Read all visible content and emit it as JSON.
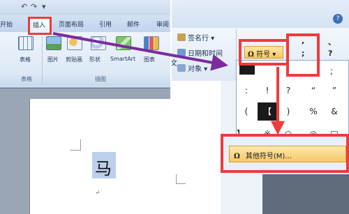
{
  "colors": {
    "highlight_red": "#ee3b3b",
    "arrow_purple": "#7b2b9e",
    "ribbon_blue": "#d6e3f3",
    "selection_blue": "#bcd0ec"
  },
  "left": {
    "qat_icons": [
      "undo-icon",
      "redo-icon",
      "customize-icon"
    ],
    "tabs": [
      "开始",
      "插入",
      "页面布局",
      "引用",
      "邮件",
      "审阅"
    ],
    "active_tab": "插入",
    "ribbon_items": [
      {
        "label": "表格",
        "icon": "table-icon"
      },
      {
        "label": "图片",
        "icon": "picture-icon"
      },
      {
        "label": "剪贴画",
        "icon": "clipart-icon"
      },
      {
        "label": "形状",
        "icon": "shapes-icon"
      },
      {
        "label": "SmartArt",
        "icon": "smartart-icon"
      },
      {
        "label": "图表",
        "icon": "chart-icon"
      }
    ],
    "groups": [
      "表格",
      "插图"
    ],
    "document_char": "马"
  },
  "right": {
    "commands": {
      "signature": "签名行",
      "datetime": "日期和时间",
      "object": "对象"
    },
    "symbol_button": {
      "glyph": "Ω",
      "label": "符号"
    },
    "side_cut": "文",
    "punct_top": [
      ",",
      "、"
    ],
    "punct_mid": [
      ";",
      "?"
    ],
    "grid": [
      [
        ";"
      ],
      [
        ":",
        "!",
        "?",
        "“",
        "”"
      ],
      [
        "(",
        "【",
        ")",
        "%",
        "&"
      ],
      [
        "】",
        "※",
        "○",
        "◎",
        "□"
      ]
    ],
    "other_symbols": {
      "glyph": "Ω",
      "label": "其他符号(M)..."
    }
  }
}
